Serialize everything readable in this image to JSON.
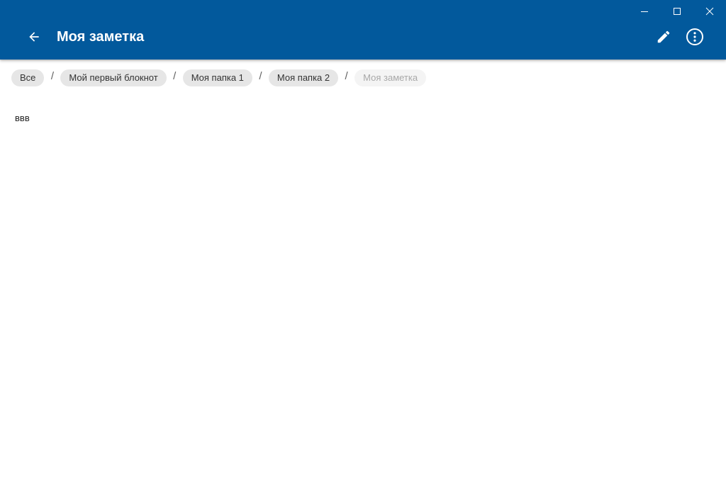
{
  "colors": {
    "app_bar": "#02599c",
    "chip": "#e6e6e6",
    "chip_current": "#f4f4f4"
  },
  "window": {
    "minimize_icon": "minimize-icon",
    "maximize_icon": "maximize-icon",
    "close_icon": "close-icon"
  },
  "header": {
    "title": "Моя заметка",
    "back_icon": "arrow-left-icon",
    "edit_icon": "pencil-icon",
    "more_icon": "more-vertical-circle-icon"
  },
  "breadcrumb": {
    "separator": "/",
    "items": [
      {
        "label": "Все"
      },
      {
        "label": "Мой первый блокнот"
      },
      {
        "label": "Моя папка 1"
      },
      {
        "label": "Моя папка 2"
      },
      {
        "label": "Моя заметка",
        "current": true
      }
    ]
  },
  "note": {
    "content": "ввв"
  }
}
